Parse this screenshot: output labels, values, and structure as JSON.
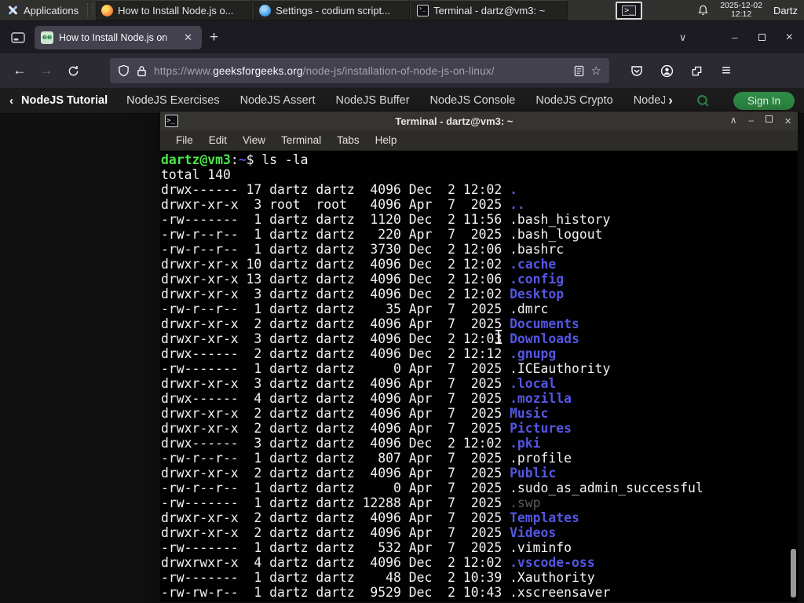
{
  "panel": {
    "applications": "Applications",
    "tasks": [
      {
        "label": "How to Install Node.js o...",
        "icon": "firefox"
      },
      {
        "label": "Settings - codium script...",
        "icon": "vscodium"
      },
      {
        "label": "Terminal - dartz@vm3: ~",
        "icon": "terminal"
      }
    ],
    "clock": {
      "date": "2025-12-02",
      "time": "12:12"
    },
    "user": "Dartz"
  },
  "browser": {
    "tab": {
      "title": "How to Install Node.js on",
      "favicon_text": "ee",
      "close": "✕"
    },
    "new_tab": "+",
    "url": {
      "prefix": "https://www.",
      "domain": "geeksforgeeks.org",
      "path": "/node-js/installation-of-node-js-on-linux/"
    },
    "controls": {
      "back": "←",
      "forward": "→",
      "alltabs": "∨",
      "minimize": "–",
      "close": "×",
      "star": "☆",
      "menu": "≡"
    }
  },
  "site_nav": {
    "back_chevron": "‹",
    "primary": "NodeJS Tutorial",
    "items": [
      "NodeJS Exercises",
      "NodeJS Assert",
      "NodeJS Buffer",
      "NodeJS Console",
      "NodeJS Crypto",
      "NodeJS DNS",
      "Node"
    ],
    "more_chevron": "›",
    "sign_in": "Sign In"
  },
  "terminal": {
    "title": "Terminal - dartz@vm3: ~",
    "menu": [
      "File",
      "Edit",
      "View",
      "Terminal",
      "Tabs",
      "Help"
    ],
    "window_controls": {
      "shade": "∧",
      "minimize": "–",
      "close": "×"
    },
    "prompt": {
      "user_host": "dartz@vm3",
      "separator": ":",
      "path": "~",
      "command": "$ ls -la"
    },
    "listing": [
      {
        "t": "total 140",
        "n": "",
        "c": "file"
      },
      {
        "t": "drwx------ 17 dartz dartz  4096 Dec  2 12:02 ",
        "n": ".",
        "c": "dir"
      },
      {
        "t": "drwxr-xr-x  3 root  root   4096 Apr  7  2025 ",
        "n": "..",
        "c": "dir"
      },
      {
        "t": "-rw-------  1 dartz dartz  1120 Dec  2 11:56 ",
        "n": ".bash_history",
        "c": "file"
      },
      {
        "t": "-rw-r--r--  1 dartz dartz   220 Apr  7  2025 ",
        "n": ".bash_logout",
        "c": "file"
      },
      {
        "t": "-rw-r--r--  1 dartz dartz  3730 Dec  2 12:06 ",
        "n": ".bashrc",
        "c": "file"
      },
      {
        "t": "drwxr-xr-x 10 dartz dartz  4096 Dec  2 12:02 ",
        "n": ".cache",
        "c": "dir"
      },
      {
        "t": "drwxr-xr-x 13 dartz dartz  4096 Dec  2 12:06 ",
        "n": ".config",
        "c": "dir"
      },
      {
        "t": "drwxr-xr-x  3 dartz dartz  4096 Dec  2 12:02 ",
        "n": "Desktop",
        "c": "dir"
      },
      {
        "t": "-rw-r--r--  1 dartz dartz    35 Apr  7  2025 ",
        "n": ".dmrc",
        "c": "file"
      },
      {
        "t": "drwxr-xr-x  2 dartz dartz  4096 Apr  7  2025 ",
        "n": "Documents",
        "c": "dir"
      },
      {
        "t": "drwxr-xr-x  3 dartz dartz  4096 Dec  2 12:03 ",
        "n": "Downloads",
        "c": "dir"
      },
      {
        "t": "drwx------  2 dartz dartz  4096 Dec  2 12:12 ",
        "n": ".gnupg",
        "c": "dir"
      },
      {
        "t": "-rw-------  1 dartz dartz     0 Apr  7  2025 ",
        "n": ".ICEauthority",
        "c": "file"
      },
      {
        "t": "drwxr-xr-x  3 dartz dartz  4096 Apr  7  2025 ",
        "n": ".local",
        "c": "dir"
      },
      {
        "t": "drwx------  4 dartz dartz  4096 Apr  7  2025 ",
        "n": ".mozilla",
        "c": "dir"
      },
      {
        "t": "drwxr-xr-x  2 dartz dartz  4096 Apr  7  2025 ",
        "n": "Music",
        "c": "dir"
      },
      {
        "t": "drwxr-xr-x  2 dartz dartz  4096 Apr  7  2025 ",
        "n": "Pictures",
        "c": "dir"
      },
      {
        "t": "drwx------  3 dartz dartz  4096 Dec  2 12:02 ",
        "n": ".pki",
        "c": "dir"
      },
      {
        "t": "-rw-r--r--  1 dartz dartz   807 Apr  7  2025 ",
        "n": ".profile",
        "c": "file"
      },
      {
        "t": "drwxr-xr-x  2 dartz dartz  4096 Apr  7  2025 ",
        "n": "Public",
        "c": "dir"
      },
      {
        "t": "-rw-r--r--  1 dartz dartz     0 Apr  7  2025 ",
        "n": ".sudo_as_admin_successful",
        "c": "file"
      },
      {
        "t": "-rw-------  1 dartz dartz 12288 Apr  7  2025 ",
        "n": ".swp",
        "c": "dim"
      },
      {
        "t": "drwxr-xr-x  2 dartz dartz  4096 Apr  7  2025 ",
        "n": "Templates",
        "c": "dir"
      },
      {
        "t": "drwxr-xr-x  2 dartz dartz  4096 Apr  7  2025 ",
        "n": "Videos",
        "c": "dir"
      },
      {
        "t": "-rw-------  1 dartz dartz   532 Apr  7  2025 ",
        "n": ".viminfo",
        "c": "file"
      },
      {
        "t": "drwxrwxr-x  4 dartz dartz  4096 Dec  2 12:02 ",
        "n": ".vscode-oss",
        "c": "dir"
      },
      {
        "t": "-rw-------  1 dartz dartz    48 Dec  2 10:39 ",
        "n": ".Xauthority",
        "c": "file"
      },
      {
        "t": "-rw-rw-r--  1 dartz dartz  9529 Dec  2 10:43 ",
        "n": ".xscreensaver",
        "c": "file"
      }
    ]
  },
  "colors": {
    "prompt_green": "#4ce64c",
    "directory_blue": "#5456e0",
    "terminal_background": "#010101",
    "gfg_green": "#2f8d46",
    "firefox_toolbar": "#2b2a33",
    "panel_gray": "#30302f"
  }
}
